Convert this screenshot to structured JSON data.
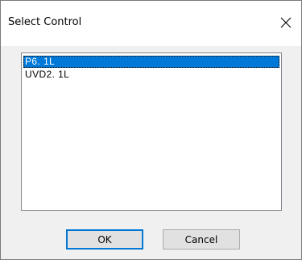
{
  "window": {
    "title": "Select Control",
    "close_icon": "close-icon"
  },
  "list": {
    "items": [
      {
        "label": "P6. 1L",
        "selected": true
      },
      {
        "label": "UVD2. 1L",
        "selected": false
      }
    ]
  },
  "buttons": {
    "ok_label": "OK",
    "cancel_label": "Cancel"
  },
  "colors": {
    "selection": "#0078d7",
    "dialog_bg": "#f0f0f0",
    "titlebar_bg": "#ffffff"
  }
}
